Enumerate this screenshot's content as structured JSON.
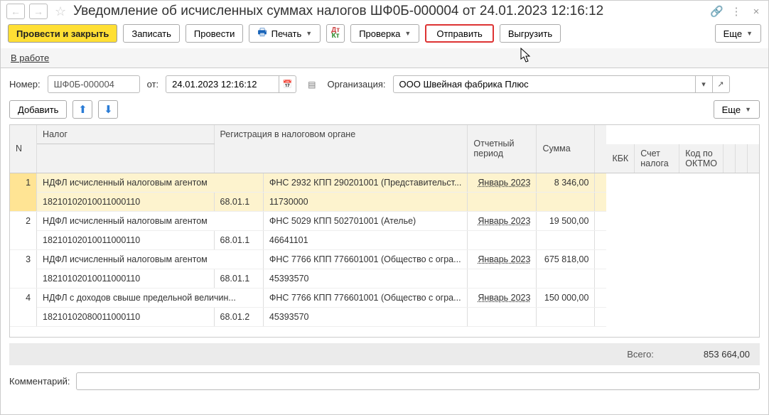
{
  "title": "Уведомление об исчисленных суммах налогов ШФ0Б-000004 от 24.01.2023 12:16:12",
  "toolbar": {
    "post_close": "Провести и закрыть",
    "write": "Записать",
    "post": "Провести",
    "print": "Печать",
    "check": "Проверка",
    "send": "Отправить",
    "upload": "Выгрузить",
    "more": "Еще"
  },
  "status": "В работе",
  "fields": {
    "number_label": "Номер:",
    "number": "ШФ0Б-000004",
    "from_label": "от:",
    "date": "24.01.2023 12:16:12",
    "org_label": "Организация:",
    "org": "ООО Швейная фабрика Плюс"
  },
  "table_toolbar": {
    "add": "Добавить",
    "more": "Еще"
  },
  "headers": {
    "n": "N",
    "tax": "Налог",
    "kbk": "КБК",
    "account": "Счет налога",
    "reg": "Регистрация в налоговом органе",
    "oktmo": "Код по ОКТМО",
    "period": "Отчетный период",
    "sum": "Сумма"
  },
  "rows": [
    {
      "n": "1",
      "tax": "НДФЛ исчисленный налоговым агентом",
      "kbk": "18210102010011000110",
      "account": "68.01.1",
      "reg": "ФНС 2932 КПП 290201001 (Представительст...",
      "oktmo": "11730000",
      "period": "Январь 2023",
      "sum": "8 346,00"
    },
    {
      "n": "2",
      "tax": "НДФЛ исчисленный налоговым агентом",
      "kbk": "18210102010011000110",
      "account": "68.01.1",
      "reg": "ФНС 5029 КПП 502701001 (Ателье)",
      "oktmo": "46641101",
      "period": "Январь 2023",
      "sum": "19 500,00"
    },
    {
      "n": "3",
      "tax": "НДФЛ исчисленный налоговым агентом",
      "kbk": "18210102010011000110",
      "account": "68.01.1",
      "reg": "ФНС 7766 КПП 776601001 (Общество с огра...",
      "oktmo": "45393570",
      "period": "Январь 2023",
      "sum": "675 818,00"
    },
    {
      "n": "4",
      "tax": "НДФЛ с доходов свыше предельной величин...",
      "kbk": "18210102080011000110",
      "account": "68.01.2",
      "reg": "ФНС 7766 КПП 776601001 (Общество с огра...",
      "oktmo": "45393570",
      "period": "Январь 2023",
      "sum": "150 000,00"
    }
  ],
  "total": {
    "label": "Всего:",
    "value": "853 664,00"
  },
  "comment_label": "Комментарий:",
  "comment": ""
}
